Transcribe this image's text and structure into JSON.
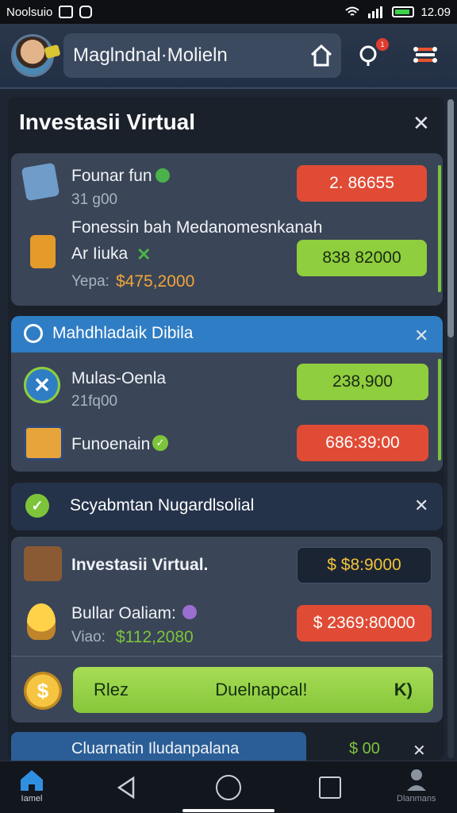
{
  "status_bar": {
    "carrier": "Noolsuio",
    "time": "12.09"
  },
  "header": {
    "title": "Maglndnal·Molieln",
    "notification_count": "1"
  },
  "panel": {
    "title": "Investasii Virtual",
    "card1": {
      "item1": {
        "name": "Founar fun",
        "sub": "31 g00",
        "value": "2. 86655"
      },
      "item2": {
        "name": "Fonessin bah Medanomesnkanah",
        "name2": "Ar Iiuka",
        "sub_label": "Yepa:",
        "sub_value": "$475,2000",
        "value": "838 82000"
      }
    },
    "section2": {
      "title": "Mahdhladaik Dibila",
      "item1": {
        "name": "Mulas-Oenla",
        "sub": "21fq00",
        "value": "238,900"
      },
      "item2": {
        "name": "Funoenain",
        "value": "686:39:00"
      }
    },
    "section3": {
      "title": "Scyabmtan Nugardlsolial",
      "item1": {
        "name": "Investasii Virtual.",
        "value": "$  $8:9000"
      },
      "item2": {
        "name": "Bullar Oaliam:",
        "sub_label": "Viao:",
        "sub_value": "$112,2080",
        "value": "$ 2369:80000"
      },
      "action": {
        "left": "Rlez",
        "center": "Duelnapcal!",
        "right": "K)"
      }
    },
    "section4": {
      "title": "Cluarnatin Iludanpalana",
      "value": "$ 00"
    }
  },
  "navbar": {
    "home_label": "Iamel",
    "profile_label": "Dlanmans"
  },
  "colors": {
    "accent_blue": "#2f7dc4",
    "green": "#8fce3e",
    "red": "#e04b35",
    "gold": "#f2c23a"
  }
}
